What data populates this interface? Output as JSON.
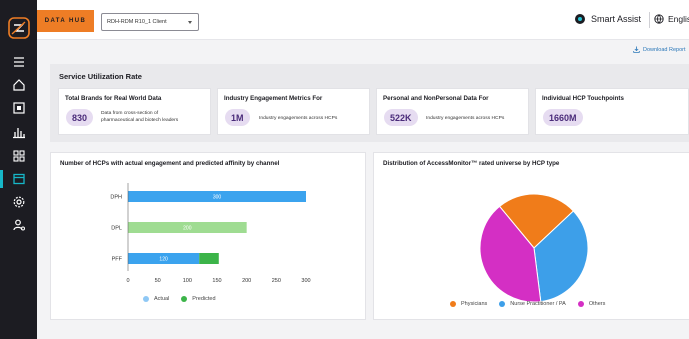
{
  "header": {
    "brand": "DATA HUB",
    "client_select": "RDH-RDM R10_1 Client",
    "smart_assist": "Smart Assist",
    "language": "English"
  },
  "download_label": "Download Report",
  "service": {
    "title": "Service Utilization Rate",
    "metrics": [
      {
        "title": "Total Brands for Real World Data",
        "value": "830",
        "desc_line1": "Data from cross-section of",
        "desc_line2": "pharmaceutical and biotech leaders"
      },
      {
        "title": "Industry Engagement Metrics For",
        "value": "1M",
        "desc_line1": "Industry engagements across HCPs",
        "desc_line2": ""
      },
      {
        "title": "Personal and NonPersonal Data For",
        "value": "522K",
        "desc_line1": "Industry engagements across HCPs",
        "desc_line2": ""
      },
      {
        "title": "Individual HCP Touchpoints",
        "value": "1660M",
        "desc_line1": "",
        "desc_line2": ""
      }
    ]
  },
  "bar_card": {
    "title": "Number of HCPs with actual engagement and predicted affinity by channel",
    "legend": [
      "Actual",
      "Predicted"
    ]
  },
  "pie_card": {
    "title": "Distribution of AccessMonitor™ rated universe by HCP type",
    "legend": [
      "Physicians",
      "Nurse Practitioner / PA",
      "Others"
    ]
  },
  "colors": {
    "actual": "#3ba3ee",
    "predicted_dark": "#3cb449",
    "predicted_light": "#9fdc92",
    "physicians": "#f07c1a",
    "nurse": "#3d9fe9",
    "others": "#d42fc4",
    "accent": "#ee7d25"
  },
  "icons": [
    "logo-icon",
    "menu-icon",
    "home-icon",
    "box-icon",
    "bar-chart-icon",
    "grid-icon",
    "window-icon",
    "gear-icon",
    "user-settings-icon"
  ],
  "chart_data": [
    {
      "type": "bar",
      "title": "Number of HCPs with actual engagement and predicted affinity by channel",
      "orientation": "horizontal",
      "stacked": true,
      "categories": [
        "DPH",
        "DPL",
        "PFF"
      ],
      "series": [
        {
          "name": "Actual",
          "values": [
            300,
            0,
            120
          ],
          "labels": [
            "300",
            "",
            "120"
          ]
        },
        {
          "name": "Predicted",
          "values": [
            0,
            200,
            33
          ],
          "labels": [
            "",
            "200",
            ""
          ]
        }
      ],
      "xticks": [
        0,
        50,
        100,
        150,
        200,
        250,
        300
      ],
      "xlim": [
        0,
        320
      ],
      "legend": "bottom",
      "grid": false
    },
    {
      "type": "pie",
      "title": "Distribution of AccessMonitor™ rated universe by HCP type",
      "categories": [
        "Physicians",
        "Nurse Practitioner / PA",
        "Others"
      ],
      "values": [
        24,
        35,
        41
      ],
      "legend": "bottom"
    }
  ]
}
